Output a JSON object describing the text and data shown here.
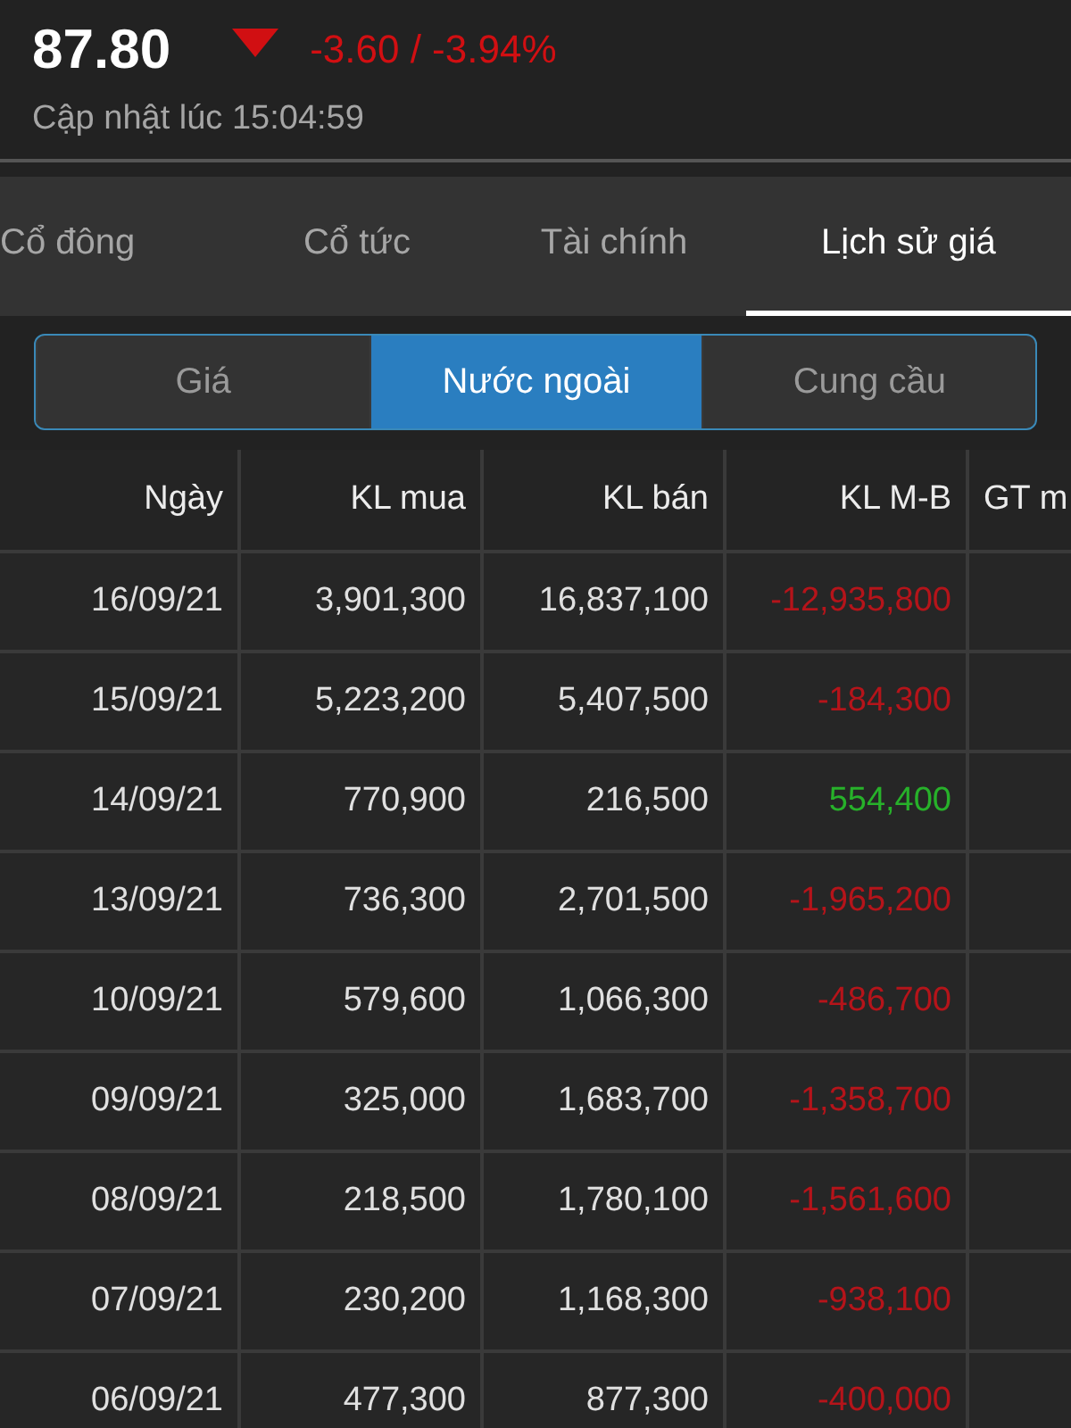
{
  "quote": {
    "price": "87.80",
    "color": "#d10f12",
    "change": "-3.60 / -3.94%",
    "updated": "Cập nhật lúc 15:04:59"
  },
  "tabs": [
    {
      "label": "Cổ đông",
      "selected": false
    },
    {
      "label": "Cổ tức",
      "selected": false
    },
    {
      "label": "Tài chính",
      "selected": false
    },
    {
      "label": "Lịch sử giá",
      "selected": true
    }
  ],
  "segments": [
    {
      "label": "Giá",
      "selected": false
    },
    {
      "label": "Nước ngoài",
      "selected": true
    },
    {
      "label": "Cung cầu",
      "selected": false
    }
  ],
  "table": {
    "columns": [
      "Ngày",
      "KL mua",
      "KL bán",
      "KL M-B",
      "GT m"
    ],
    "rows": [
      {
        "date": "16/09/21",
        "buy": "3,901,300",
        "sell": "16,837,100",
        "net": "-12,935,800",
        "color": "#b5141a"
      },
      {
        "date": "15/09/21",
        "buy": "5,223,200",
        "sell": "5,407,500",
        "net": "-184,300",
        "color": "#b5141a"
      },
      {
        "date": "14/09/21",
        "buy": "770,900",
        "sell": "216,500",
        "net": "554,400",
        "color": "#27b12a"
      },
      {
        "date": "13/09/21",
        "buy": "736,300",
        "sell": "2,701,500",
        "net": "-1,965,200",
        "color": "#b5141a"
      },
      {
        "date": "10/09/21",
        "buy": "579,600",
        "sell": "1,066,300",
        "net": "-486,700",
        "color": "#b5141a"
      },
      {
        "date": "09/09/21",
        "buy": "325,000",
        "sell": "1,683,700",
        "net": "-1,358,700",
        "color": "#b5141a"
      },
      {
        "date": "08/09/21",
        "buy": "218,500",
        "sell": "1,780,100",
        "net": "-1,561,600",
        "color": "#b5141a"
      },
      {
        "date": "07/09/21",
        "buy": "230,200",
        "sell": "1,168,300",
        "net": "-938,100",
        "color": "#b5141a"
      },
      {
        "date": "06/09/21",
        "buy": "477,300",
        "sell": "877,300",
        "net": "-400,000",
        "color": "#b5141a"
      }
    ]
  }
}
